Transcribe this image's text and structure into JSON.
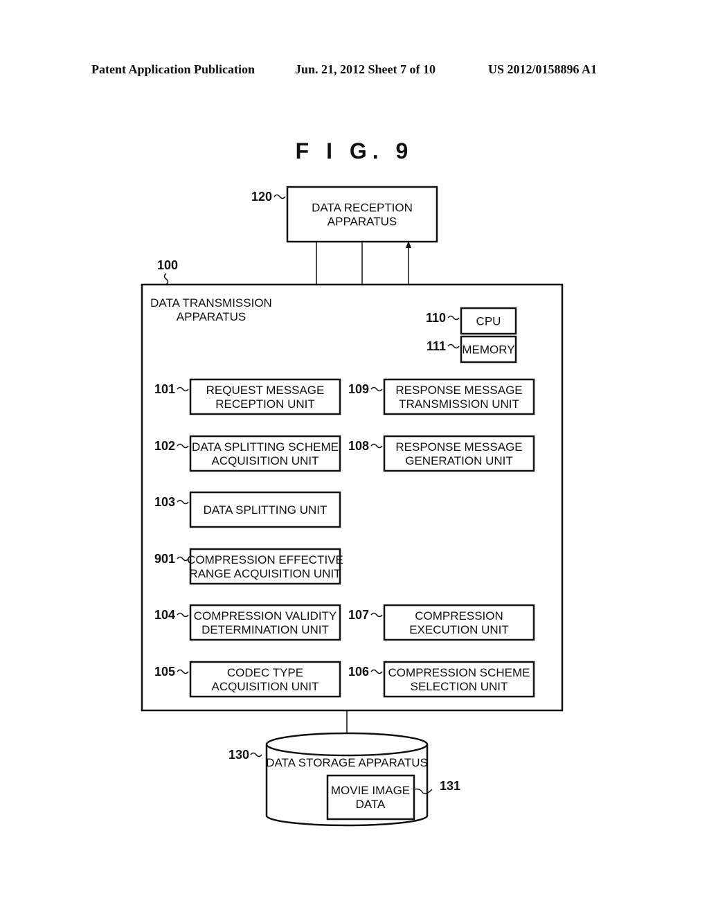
{
  "header": {
    "publication": "Patent Application Publication",
    "date_sheet": "Jun. 21, 2012  Sheet 7 of 10",
    "number": "US 2012/0158896 A1"
  },
  "figure_title": "F I G. 9",
  "nodes": {
    "n120": {
      "ref": "120",
      "lines": [
        "DATA RECEPTION",
        "APPARATUS"
      ]
    },
    "n100": {
      "ref": "100",
      "lines": [
        "DATA TRANSMISSION",
        "APPARATUS"
      ]
    },
    "n110": {
      "ref": "110",
      "lines": [
        "CPU"
      ]
    },
    "n111": {
      "ref": "111",
      "lines": [
        "MEMORY"
      ]
    },
    "n101": {
      "ref": "101",
      "lines": [
        "REQUEST MESSAGE",
        "RECEPTION UNIT"
      ]
    },
    "n102": {
      "ref": "102",
      "lines": [
        "DATA SPLITTING SCHEME",
        "ACQUISITION UNIT"
      ]
    },
    "n103": {
      "ref": "103",
      "lines": [
        "DATA SPLITTING UNIT"
      ]
    },
    "n901": {
      "ref": "901",
      "lines": [
        "COMPRESSION EFFECTIVE",
        "RANGE ACQUISITION UNIT"
      ]
    },
    "n104": {
      "ref": "104",
      "lines": [
        "COMPRESSION VALIDITY",
        "DETERMINATION UNIT"
      ]
    },
    "n105": {
      "ref": "105",
      "lines": [
        "CODEC TYPE",
        "ACQUISITION UNIT"
      ]
    },
    "n106": {
      "ref": "106",
      "lines": [
        "COMPRESSION SCHEME",
        "SELECTION UNIT"
      ]
    },
    "n107": {
      "ref": "107",
      "lines": [
        "COMPRESSION",
        "EXECUTION UNIT"
      ]
    },
    "n108": {
      "ref": "108",
      "lines": [
        "RESPONSE MESSAGE",
        "GENERATION UNIT"
      ]
    },
    "n109": {
      "ref": "109",
      "lines": [
        "RESPONSE MESSAGE",
        "TRANSMISSION UNIT"
      ]
    },
    "n130": {
      "ref": "130",
      "lines": [
        "DATA STORAGE APPARATUS"
      ]
    },
    "n131": {
      "ref": "131",
      "lines": [
        "MOVIE IMAGE",
        "DATA"
      ]
    }
  },
  "edges": [
    {
      "from": "120",
      "to": "101"
    },
    {
      "from": "101",
      "to": "102"
    },
    {
      "from": "102",
      "to": "103"
    },
    {
      "from": "103",
      "to": "901"
    },
    {
      "from": "901",
      "to": "104"
    },
    {
      "from": "104",
      "to": "105"
    },
    {
      "from": "105",
      "to": "106"
    },
    {
      "from": "106",
      "to": "107"
    },
    {
      "from": "107",
      "to": "108"
    },
    {
      "from": "108",
      "to": "109"
    },
    {
      "from": "109",
      "to": "120"
    },
    {
      "from": "120",
      "to": "100"
    },
    {
      "from": "100",
      "to": "130"
    }
  ]
}
